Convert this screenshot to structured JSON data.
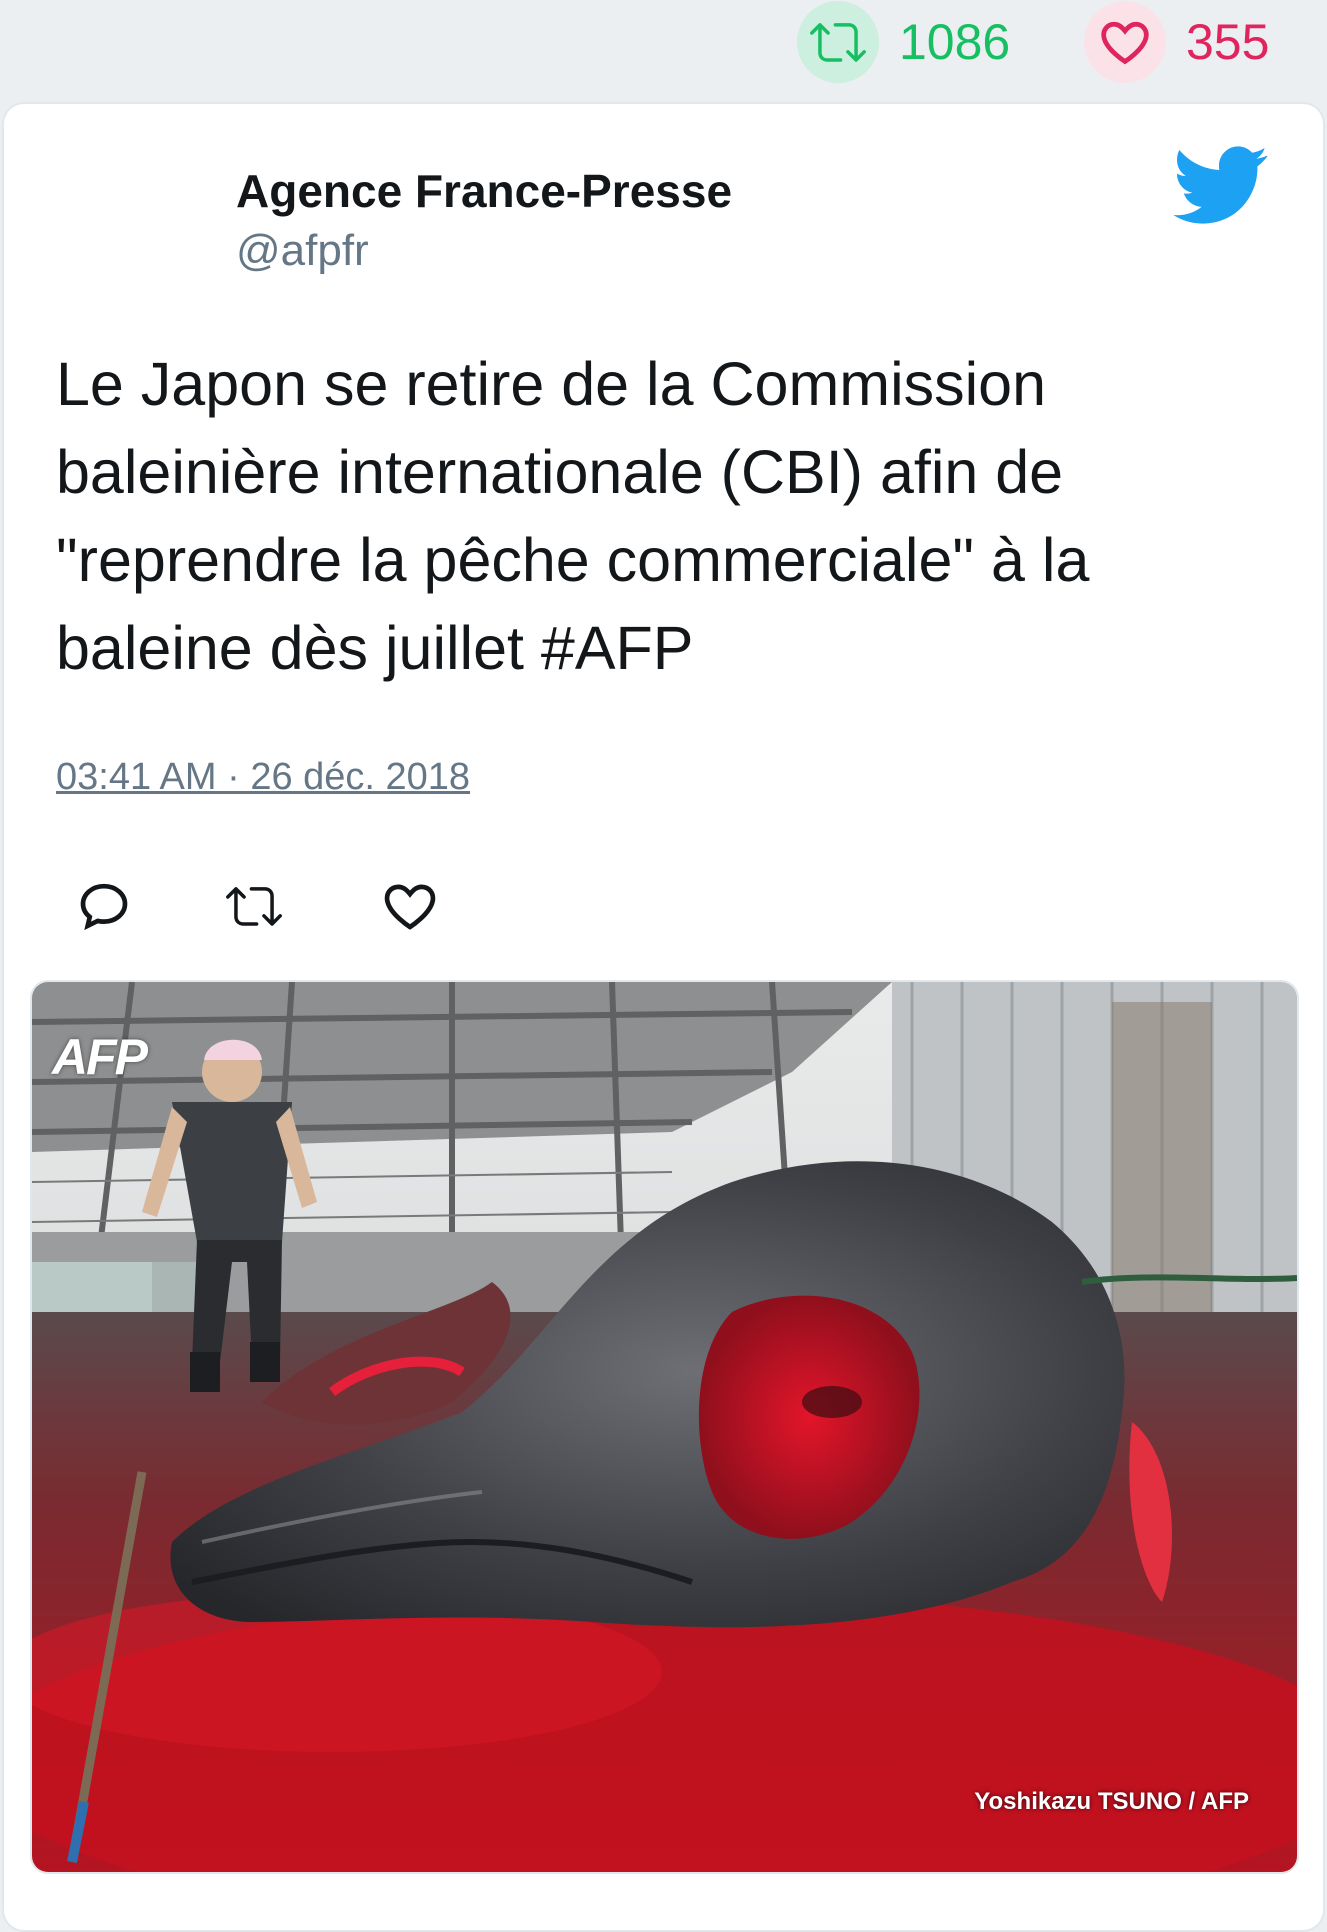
{
  "stats": {
    "retweets": "1086",
    "likes": "355",
    "retweet_color": "#17bf63",
    "like_color": "#e0245e"
  },
  "tweet": {
    "author_name": "Agence France-Presse",
    "author_handle": "@afpfr",
    "text": "Le Japon se retire de la Commission baleinière internationale (CBI) afin de \"reprendre la pêche commerciale\" à la baleine dès juillet #AFP",
    "timestamp": "03:41 AM · 26 déc. 2018",
    "brand_icon": "twitter-bird-icon",
    "brand_color": "#1da1f2"
  },
  "actions": {
    "reply_icon": "reply-icon",
    "retweet_icon": "retweet-icon",
    "like_icon": "heart-icon"
  },
  "media": {
    "logo": "AFP",
    "credit": "Yoshikazu TSUNO / AFP"
  }
}
